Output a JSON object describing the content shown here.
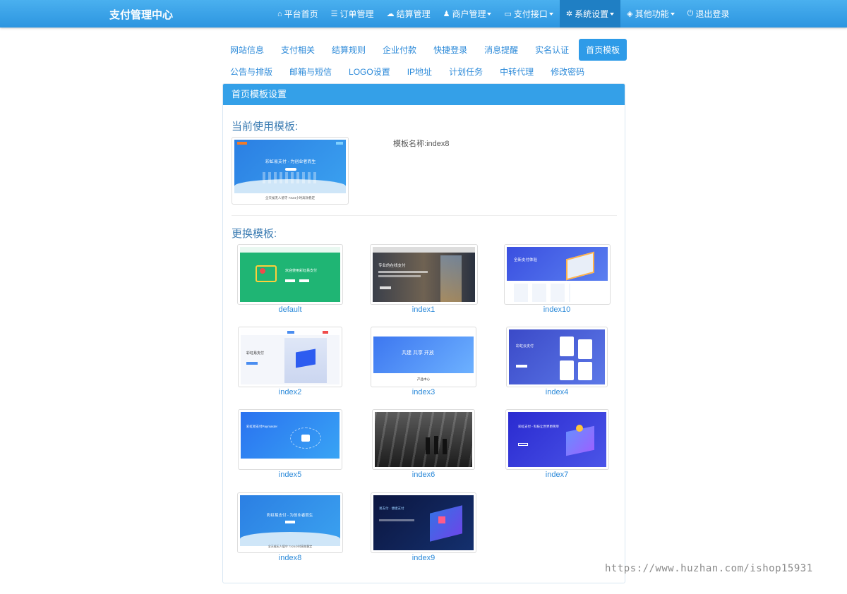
{
  "header": {
    "brand": "支付管理中心",
    "nav": [
      {
        "icon": "home-icon",
        "glyph": "⌂",
        "label": "平台首页",
        "dropdown": false,
        "active": false
      },
      {
        "icon": "list-icon",
        "glyph": "☰",
        "label": "订单管理",
        "dropdown": false,
        "active": false
      },
      {
        "icon": "cloud-icon",
        "glyph": "☁",
        "label": "结算管理",
        "dropdown": false,
        "active": false
      },
      {
        "icon": "user-icon",
        "glyph": "♟",
        "label": "商户管理",
        "dropdown": true,
        "active": false
      },
      {
        "icon": "credit-card-icon",
        "glyph": "▭",
        "label": "支付接口",
        "dropdown": true,
        "active": false
      },
      {
        "icon": "gear-icon",
        "glyph": "✲",
        "label": "系统设置",
        "dropdown": true,
        "active": true
      },
      {
        "icon": "cube-icon",
        "glyph": "◈",
        "label": "其他功能",
        "dropdown": true,
        "active": false
      },
      {
        "icon": "power-icon",
        "glyph": "⏻",
        "label": "退出登录",
        "dropdown": false,
        "active": false
      }
    ]
  },
  "tabs": {
    "row1": [
      "网站信息",
      "支付相关",
      "结算规则",
      "企业付款",
      "快捷登录",
      "消息提醒",
      "实名认证",
      "首页模板"
    ],
    "row2": [
      "公告与排版",
      "邮箱与短信",
      "LOGO设置",
      "IP地址",
      "计划任务",
      "中转代理",
      "修改密码"
    ],
    "active": "首页模板"
  },
  "panel": {
    "title": "首页模板设置",
    "current_heading": "当前使用模板:",
    "current_name_label": "模板名称:",
    "current_name": "index8",
    "change_heading": "更换模板:"
  },
  "templates": [
    "default",
    "index1",
    "index10",
    "index2",
    "index3",
    "index4",
    "index5",
    "index6",
    "index7",
    "index8",
    "index9"
  ],
  "thumb_text": {
    "current_hero": "彩虹易支付 - 为创业者而生",
    "current_footer": "全天候无人值守 7X24小时高效稳定",
    "default_hero": "欢迎使用彩虹易支付",
    "index1_hero": "专业的在线支付",
    "index10_hero": "全新支付体验",
    "index2_hero": "彩虹易支付",
    "index3_hero": "共建  共享  开放",
    "index3_sub": "产品中心",
    "index4_hero": "彩虹云支付",
    "index5_hero": "彩虹易支付Paymaster",
    "index7_hero": "彩虹支付 - 科技让世界更简单",
    "index8_hero": "彩虹易支付 - 为创业者而生",
    "index8_footer": "全天候无人值守 7X24小时高效稳定",
    "index9_hero": "易支付 · 便捷支付"
  },
  "colors": {
    "nav_bg": "#3aa3e8",
    "accent": "#2e9be8",
    "link": "#2c8ad9"
  },
  "watermark": "https://www.huzhan.com/ishop15931"
}
